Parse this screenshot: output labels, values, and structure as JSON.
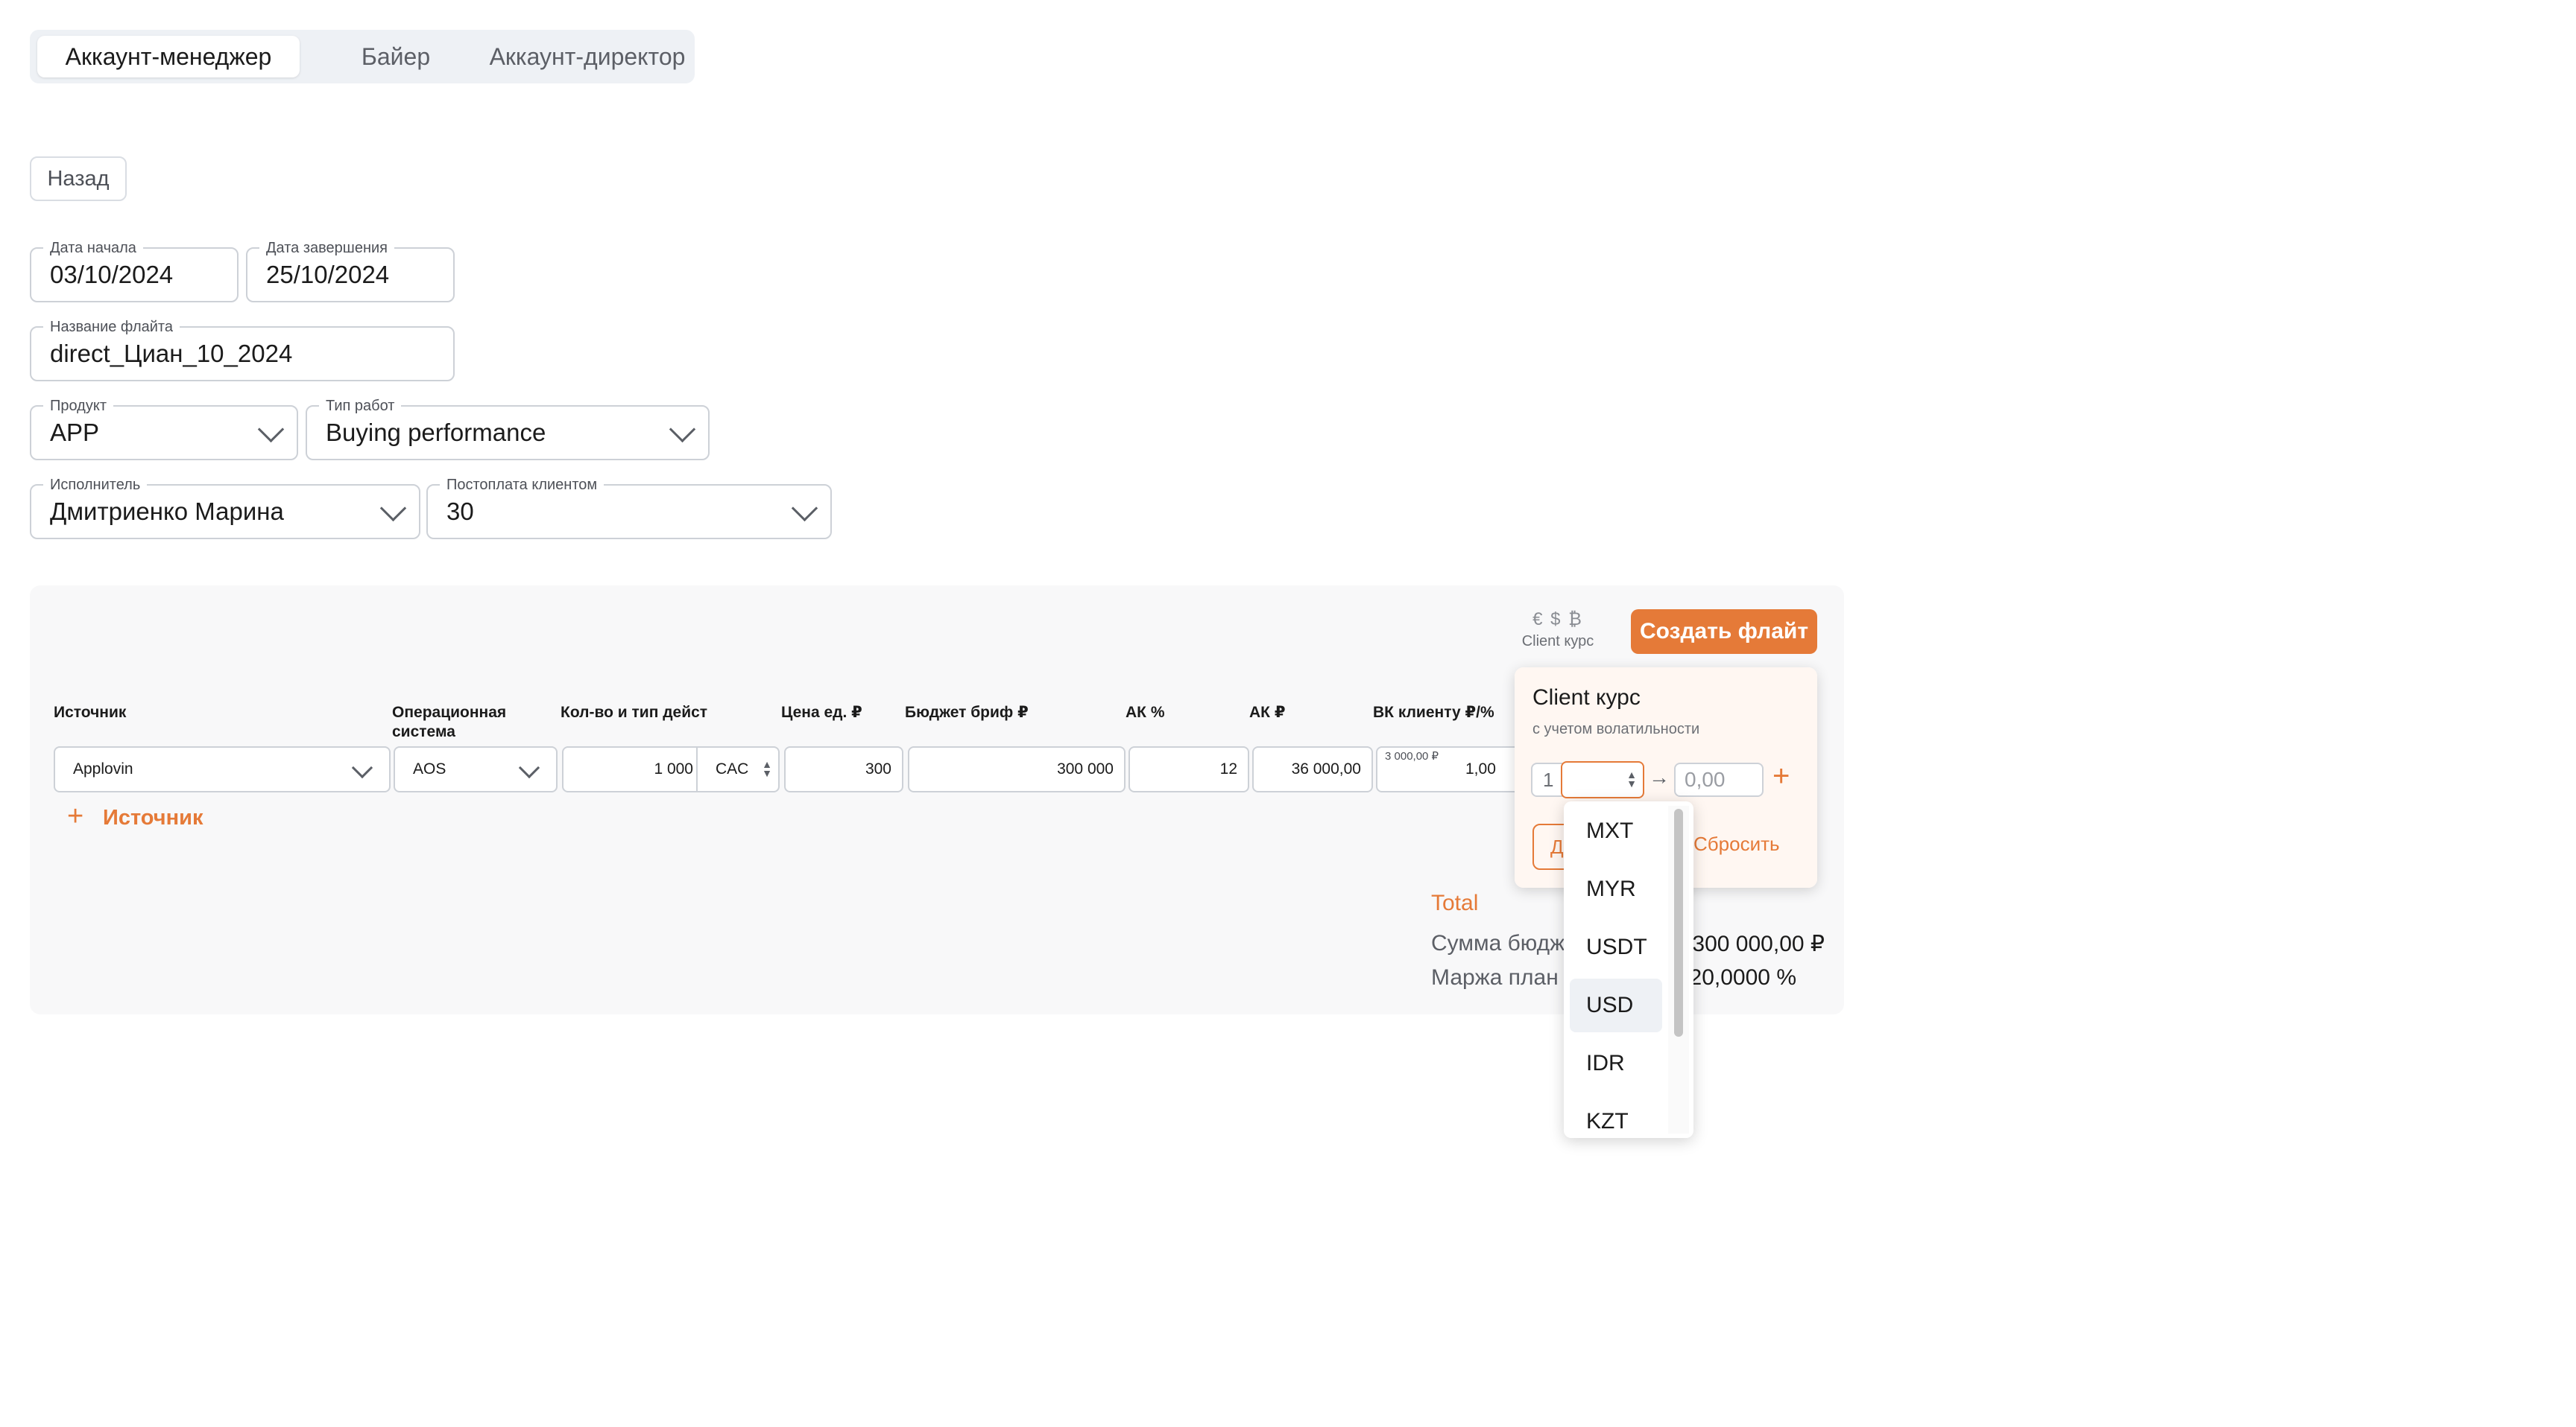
{
  "tabs": [
    "Аккаунт-менеджер",
    "Байер",
    "Аккаунт-директор"
  ],
  "back_label": "Назад",
  "form": {
    "start_date": {
      "label": "Дата начала",
      "value": "03/10/2024"
    },
    "end_date": {
      "label": "Дата завершения",
      "value": "25/10/2024"
    },
    "flight_name": {
      "label": "Название флайта",
      "value": "direct_Циан_10_2024"
    },
    "product": {
      "label": "Продукт",
      "value": "APP"
    },
    "work_type": {
      "label": "Тип работ",
      "value": "Buying performance"
    },
    "executor": {
      "label": "Исполнитель",
      "value": "Дмитриенко Марина"
    },
    "postpay": {
      "label": "Постоплата клиентом",
      "value": "30"
    }
  },
  "currency_icons": "€ $ ₿",
  "client_rate_link": "Client курс",
  "create_button": "Создать флайт",
  "table": {
    "headers": {
      "source": "Источник",
      "os": "Операционная система",
      "qty": "Кол-во и тип дейст",
      "unit_price": "Цена ед. ₽",
      "budget": "Бюджет бриф ₽",
      "ak_pct": "АК %",
      "ak_rub": "АК ₽",
      "vk": "ВК клиенту ₽/%"
    },
    "row": {
      "source": "Applovin",
      "os": "AOS",
      "qty": "1 000",
      "action_type": "CAC",
      "unit_price": "300",
      "budget": "300 000",
      "ak_pct": "12",
      "ak_rub": "36 000,00",
      "vk_top": "3 000,00 ₽",
      "vk_value": "1,00"
    },
    "add_source": "Источник"
  },
  "totals": {
    "title": "Total",
    "budget_label": "Сумма бюдже",
    "budget_value": "300 000,00 ₽",
    "margin_label": "Маржа план %",
    "margin_value": "20,0000 %"
  },
  "popover": {
    "title": "Client курс",
    "subtitle": "с учетом волатильности",
    "from_value": "1",
    "to_placeholder": "0,00",
    "apply_label": "Д",
    "reset_label": "Сбросить"
  },
  "currency_options": [
    "MXT",
    "MYR",
    "USDT",
    "USD",
    "IDR",
    "KZT"
  ],
  "selected_currency": "USD",
  "colors": {
    "accent": "#e57a38",
    "border": "#cdd1d7",
    "panel": "#f8f8f9"
  }
}
